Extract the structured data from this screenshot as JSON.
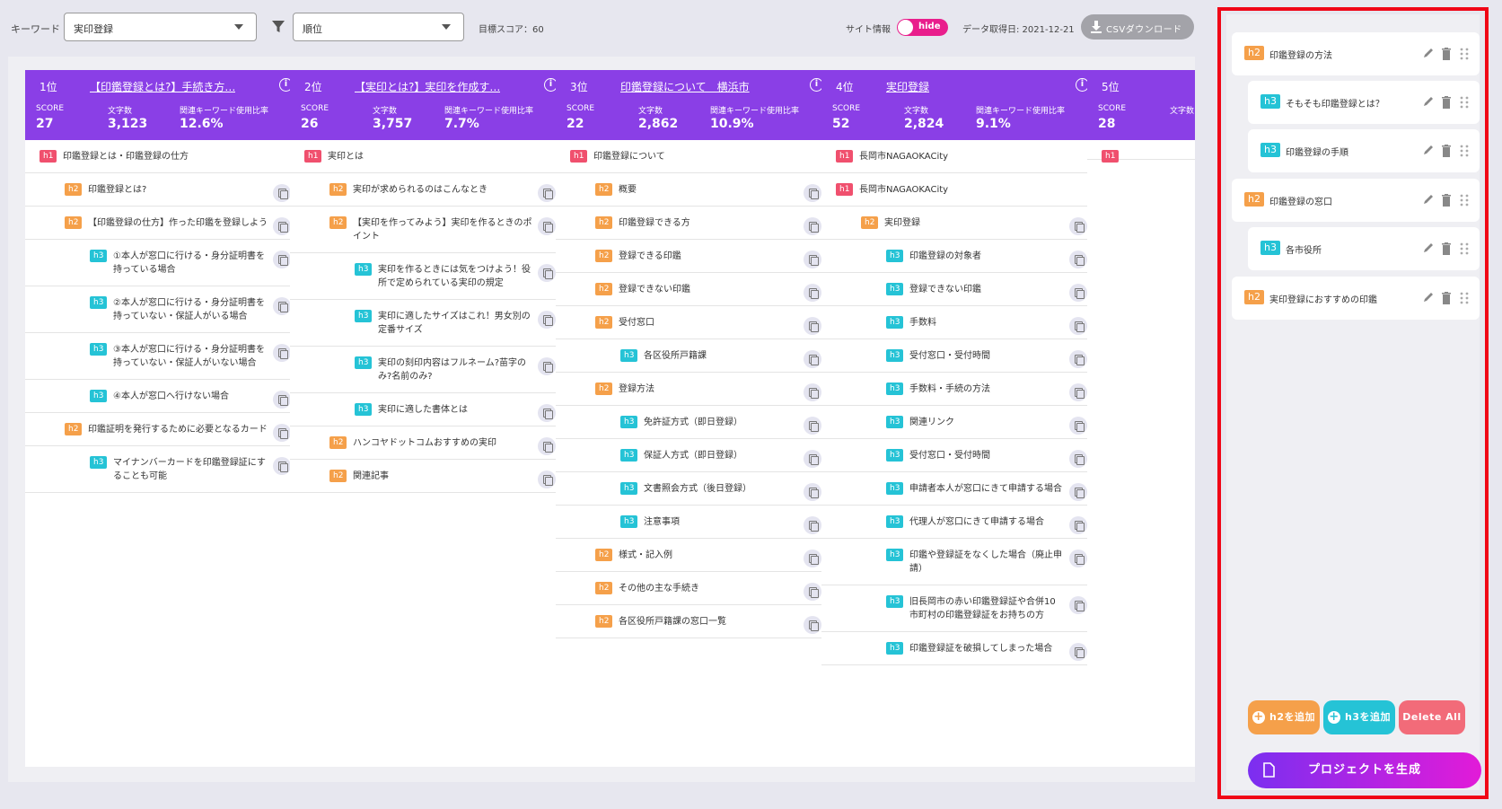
{
  "toolbar": {
    "keyword_label": "キーワード",
    "keyword_value": "実印登録",
    "sort_value": "順位",
    "target_score": "目標スコア：60",
    "site_info_label": "サイト情報",
    "toggle_label": "hide",
    "fetch_date": "データ取得日: 2021-12-21",
    "csv_label": "CSVダウンロード"
  },
  "metric_labels": {
    "score": "SCORE",
    "chars": "文字数",
    "ratio": "関連キーワード使用比率"
  },
  "columns": [
    {
      "rank": "1位",
      "title": "【印鑑登録とは?】手続き方…",
      "score": "27",
      "chars": "3,123",
      "ratio": "12.6%",
      "rows": [
        {
          "tag": "h1",
          "text": "印鑑登録とは・印鑑登録の仕方"
        },
        {
          "tag": "h2",
          "text": "印鑑登録とは?"
        },
        {
          "tag": "h2",
          "text": "【印鑑登録の仕方】作った印鑑を登録しよう"
        },
        {
          "tag": "h3",
          "text": "①本人が窓口に行ける・身分証明書を持っている場合"
        },
        {
          "tag": "h3",
          "text": "②本人が窓口に行ける・身分証明書を持っていない・保証人がいる場合"
        },
        {
          "tag": "h3",
          "text": "③本人が窓口に行ける・身分証明書を持っていない・保証人がいない場合"
        },
        {
          "tag": "h3",
          "text": "④本人が窓口へ行けない場合"
        },
        {
          "tag": "h2",
          "text": "印鑑証明を発行するために必要となるカード"
        },
        {
          "tag": "h3",
          "text": "マイナンバーカードを印鑑登録証にすることも可能"
        }
      ]
    },
    {
      "rank": "2位",
      "title": "【実印とは?】実印を作成す…",
      "score": "26",
      "chars": "3,757",
      "ratio": "7.7%",
      "rows": [
        {
          "tag": "h1",
          "text": "実印とは"
        },
        {
          "tag": "h2",
          "text": "実印が求められるのはこんなとき"
        },
        {
          "tag": "h2",
          "text": "【実印を作ってみよう】実印を作るときのポイント"
        },
        {
          "tag": "h3",
          "text": "実印を作るときには気をつけよう！役所で定められている実印の規定"
        },
        {
          "tag": "h3",
          "text": "実印に適したサイズはこれ！男女別の定番サイズ"
        },
        {
          "tag": "h3",
          "text": "実印の刻印内容はフルネーム?苗字のみ?名前のみ?"
        },
        {
          "tag": "h3",
          "text": "実印に適した書体とは"
        },
        {
          "tag": "h2",
          "text": "ハンコヤドットコムおすすめの実印"
        },
        {
          "tag": "h2",
          "text": "関連記事"
        }
      ]
    },
    {
      "rank": "3位",
      "title": "印鑑登録について　横浜市",
      "score": "22",
      "chars": "2,862",
      "ratio": "10.9%",
      "rows": [
        {
          "tag": "h1",
          "text": "印鑑登録について"
        },
        {
          "tag": "h2",
          "text": "概要"
        },
        {
          "tag": "h2",
          "text": "印鑑登録できる方"
        },
        {
          "tag": "h2",
          "text": "登録できる印鑑"
        },
        {
          "tag": "h2",
          "text": "登録できない印鑑"
        },
        {
          "tag": "h2",
          "text": "受付窓口"
        },
        {
          "tag": "h3",
          "text": "各区役所戸籍課"
        },
        {
          "tag": "h2",
          "text": "登録方法"
        },
        {
          "tag": "h3",
          "text": "免許証方式（即日登録）"
        },
        {
          "tag": "h3",
          "text": "保証人方式（即日登録）"
        },
        {
          "tag": "h3",
          "text": "文書照会方式（後日登録）"
        },
        {
          "tag": "h3",
          "text": "注意事項"
        },
        {
          "tag": "h2",
          "text": "様式・記入例"
        },
        {
          "tag": "h2",
          "text": "その他の主な手続き"
        },
        {
          "tag": "h2",
          "text": "各区役所戸籍課の窓口一覧"
        }
      ]
    },
    {
      "rank": "4位",
      "title": "実印登録",
      "score": "52",
      "chars": "2,824",
      "ratio": "9.1%",
      "rows": [
        {
          "tag": "h1",
          "text": "長岡市NAGAOKACity"
        },
        {
          "tag": "h1",
          "text": "長岡市NAGAOKACity"
        },
        {
          "tag": "h2",
          "text": "実印登録"
        },
        {
          "tag": "h3",
          "text": "印鑑登録の対象者"
        },
        {
          "tag": "h3",
          "text": "登録できない印鑑"
        },
        {
          "tag": "h3",
          "text": "手数料"
        },
        {
          "tag": "h3",
          "text": "受付窓口・受付時間"
        },
        {
          "tag": "h3",
          "text": "手数料・手続の方法"
        },
        {
          "tag": "h3",
          "text": "関連リンク"
        },
        {
          "tag": "h3",
          "text": "受付窓口・受付時間"
        },
        {
          "tag": "h3",
          "text": "申請者本人が窓口にきて申請する場合"
        },
        {
          "tag": "h3",
          "text": "代理人が窓口にきて申請する場合"
        },
        {
          "tag": "h3",
          "text": "印鑑や登録証をなくした場合（廃止申請）"
        },
        {
          "tag": "h3",
          "text": "旧長岡市の赤い印鑑登録証や合併10市町村の印鑑登録証をお持ちの方"
        },
        {
          "tag": "h3",
          "text": "印鑑登録証を破損してしまった場合"
        }
      ]
    },
    {
      "rank": "5位",
      "title": "",
      "score": "28",
      "chars": "",
      "ratio": "",
      "rows": [
        {
          "tag": "h1",
          "text": ""
        }
      ]
    }
  ],
  "outline": {
    "items": [
      {
        "tag": "h2",
        "text": "印鑑登録の方法"
      },
      {
        "tag": "h3",
        "text": "そもそも印鑑登録とは？"
      },
      {
        "tag": "h3",
        "text": "印鑑登録の手順"
      },
      {
        "tag": "h2",
        "text": "印鑑登録の窓口"
      },
      {
        "tag": "h3",
        "text": "各市役所"
      },
      {
        "tag": "h2",
        "text": "実印登録におすすめの印鑑"
      }
    ],
    "add_h2": "h2を追加",
    "add_h3": "h3を追加",
    "delete_all": "Delete All",
    "generate": "プロジェクトを生成"
  },
  "colors": {
    "header": "#8a3fe6",
    "h1": "#f0506e",
    "h2": "#f5a04a",
    "h3": "#25c3d6",
    "toggle": "#e91e8c",
    "panel_border": "#f00516"
  }
}
